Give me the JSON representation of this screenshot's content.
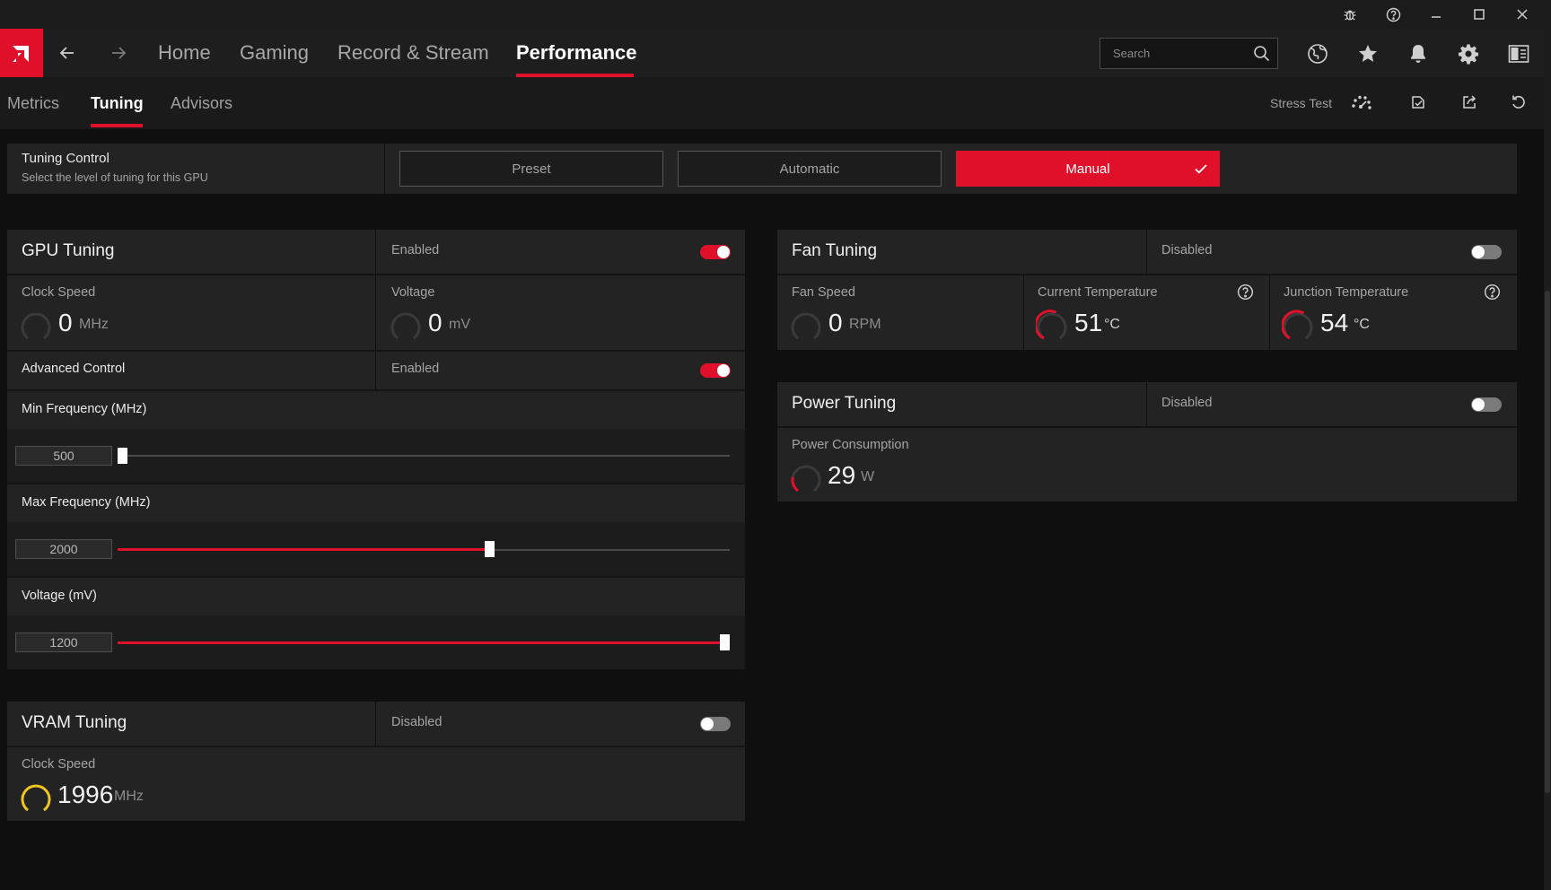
{
  "nav": {
    "home": "Home",
    "gaming": "Gaming",
    "record_stream": "Record & Stream",
    "performance": "Performance",
    "active": "performance"
  },
  "search": {
    "placeholder": "Search"
  },
  "subnav": {
    "metrics": "Metrics",
    "tuning": "Tuning",
    "advisors": "Advisors",
    "stress_test": "Stress Test"
  },
  "tuning_control": {
    "title": "Tuning Control",
    "subtitle": "Select the level of tuning for this GPU",
    "options": [
      "Preset",
      "Automatic",
      "Manual"
    ],
    "selected": "Manual"
  },
  "gpu_tuning": {
    "title": "GPU Tuning",
    "status": "Enabled",
    "enabled": true,
    "clock_speed": {
      "label": "Clock Speed",
      "value": "0",
      "unit": "MHz"
    },
    "voltage": {
      "label": "Voltage",
      "value": "0",
      "unit": "mV"
    },
    "advanced_control": {
      "label": "Advanced Control",
      "status": "Enabled",
      "enabled": true
    },
    "min_frequency": {
      "label": "Min Frequency (MHz)",
      "value": "500",
      "fraction": 0.0
    },
    "max_frequency": {
      "label": "Max Frequency (MHz)",
      "value": "2000",
      "fraction": 0.61
    },
    "voltage_slider": {
      "label": "Voltage (mV)",
      "value": "1200",
      "fraction": 1.0
    }
  },
  "vram_tuning": {
    "title": "VRAM Tuning",
    "status": "Disabled",
    "enabled": false,
    "clock_speed": {
      "label": "Clock Speed",
      "value": "1996",
      "unit": "MHz"
    }
  },
  "fan_tuning": {
    "title": "Fan Tuning",
    "status": "Disabled",
    "enabled": false,
    "fan_speed": {
      "label": "Fan Speed",
      "value": "0",
      "unit": "RPM"
    },
    "current_temperature": {
      "label": "Current Temperature",
      "value": "51",
      "unit": "°C"
    },
    "junction_temperature": {
      "label": "Junction Temperature",
      "value": "54",
      "unit": "°C"
    }
  },
  "power_tuning": {
    "title": "Power Tuning",
    "status": "Disabled",
    "enabled": false,
    "power_consumption": {
      "label": "Power Consumption",
      "value": "29",
      "unit": "W"
    }
  },
  "colors": {
    "accent": "#e0102b",
    "gauge_idle": "#3a3a3a",
    "gauge_yellow": "#f2c51d",
    "panel": "#232323",
    "background": "#0f0f0f"
  },
  "icons": {
    "logo": "amd-logo-icon",
    "titlebar": [
      "bug-icon",
      "help-icon",
      "minimize-icon",
      "maximize-icon",
      "close-icon"
    ],
    "header": [
      "globe-icon",
      "star-icon",
      "bell-icon",
      "gear-icon",
      "sidebar-toggle-icon"
    ],
    "subnav": [
      "stress-test-icon",
      "checklist-icon",
      "export-icon",
      "reset-icon"
    ]
  }
}
